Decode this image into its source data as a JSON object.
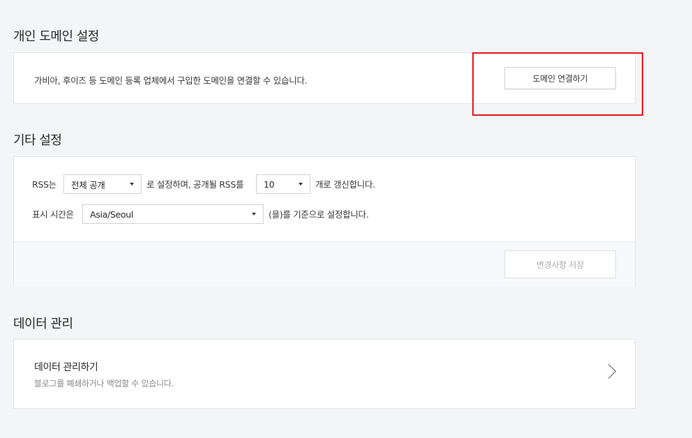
{
  "domain_section": {
    "title": "개인 도메인 설정",
    "description": "가비아, 후이즈 등 도메인 등록 업체에서 구입한 도메인을 연결할 수 있습니다.",
    "connect_button": "도메인 연결하기"
  },
  "etc_section": {
    "title": "기타 설정",
    "rss_prefix": "RSS는",
    "rss_visibility": "전체 공개",
    "rss_middle": "로 설정하며, 공개될 RSS를",
    "rss_count": "10",
    "rss_suffix": "개로 갱신합니다.",
    "time_prefix": "표시 시간은",
    "timezone": "Asia/Seoul",
    "time_suffix": "(을)를 기준으로 설정합니다.",
    "save_button": "변경사항 저장"
  },
  "data_section": {
    "title": "데이터 관리",
    "item_title": "데이터 관리하기",
    "item_desc": "블로그를 폐쇄하거나 백업할 수 있습니다."
  },
  "colors": {
    "highlight": "#e8101a",
    "background": "#f4f5f6"
  }
}
